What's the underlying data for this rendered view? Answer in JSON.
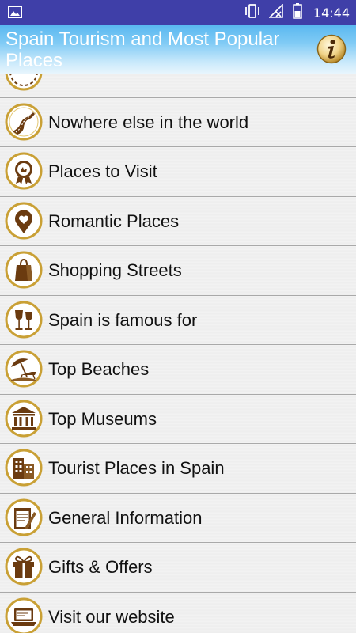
{
  "status_bar": {
    "time": "14:44",
    "icons": [
      "image-icon",
      "vibrate-icon",
      "no-signal-icon",
      "battery-icon"
    ]
  },
  "header": {
    "title": "Spain Tourism and Most Popular Places",
    "info_icon": "info-icon",
    "colors": {
      "gradient_top": "#5ab8f0",
      "gradient_bottom": "#eaf6fd"
    }
  },
  "list": {
    "items": [
      {
        "label": "",
        "icon": "partial-icon"
      },
      {
        "label": "Nowhere else in the world",
        "icon": "road-icon"
      },
      {
        "label": "Places to Visit",
        "icon": "award-badge-icon"
      },
      {
        "label": "Romantic Places",
        "icon": "heart-pin-icon"
      },
      {
        "label": "Shopping Streets",
        "icon": "shopping-bag-icon"
      },
      {
        "label": "Spain is famous for",
        "icon": "wine-glasses-icon"
      },
      {
        "label": "Top Beaches",
        "icon": "beach-umbrella-icon"
      },
      {
        "label": "Top Museums",
        "icon": "museum-icon"
      },
      {
        "label": "Tourist Places in Spain",
        "icon": "buildings-icon"
      },
      {
        "label": "General Information",
        "icon": "notepad-icon"
      },
      {
        "label": "Gifts & Offers",
        "icon": "gift-icon"
      },
      {
        "label": "Visit our website",
        "icon": "laptop-icon"
      }
    ]
  },
  "colors": {
    "icon_gold": "#c9a035",
    "icon_brown": "#6b3b10",
    "status_bar": "#3f3fa8"
  }
}
